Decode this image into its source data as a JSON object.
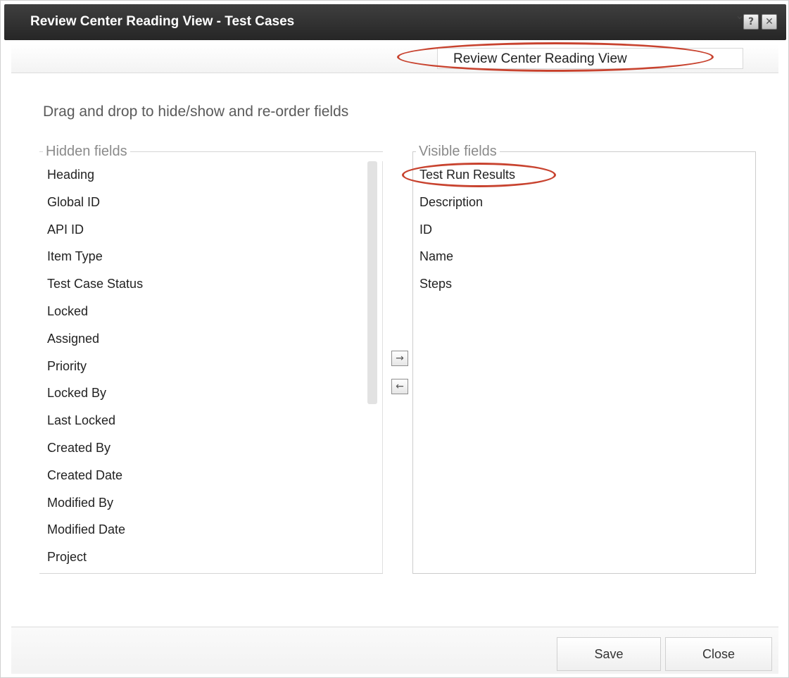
{
  "window": {
    "title": "Review Center Reading View - Test Cases",
    "help_icon": "?",
    "close_icon": "✕"
  },
  "view_selector": {
    "selected": "Review Center Reading View",
    "arrow_icon": "chevron-down-icon"
  },
  "instruction": "Drag and drop to hide/show and re-order fields",
  "hidden_fields": {
    "title": "Hidden fields",
    "items": [
      "Heading",
      "Global ID",
      "API ID",
      "Item Type",
      "Test Case Status",
      "Locked",
      "Assigned",
      "Priority",
      "Locked By",
      "Last Locked",
      "Created By",
      "Created Date",
      "Modified By",
      "Modified Date",
      "Project"
    ]
  },
  "visible_fields": {
    "title": "Visible fields",
    "items": [
      "Test Run Results",
      "Description",
      "ID",
      "Name",
      "Steps"
    ]
  },
  "move_buttons": {
    "right_glyph": "→",
    "left_glyph": "←"
  },
  "footer": {
    "save_label": "Save",
    "close_label": "Close"
  },
  "annotation_color": "#c8432f"
}
